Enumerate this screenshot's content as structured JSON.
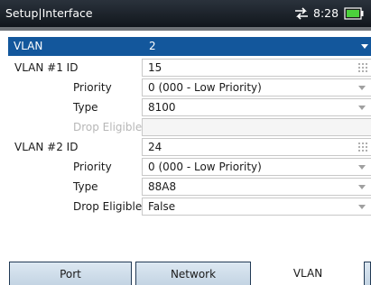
{
  "title_bar": {
    "title": "Setup|Interface",
    "time": "8:28",
    "network_icon": "network-transfer-icon",
    "battery_icon": "battery-icon"
  },
  "vlan": {
    "label": "VLAN",
    "value": "2"
  },
  "vlan1": {
    "id_label": "VLAN #1 ID",
    "id_value": "15",
    "priority_label": "Priority",
    "priority_value": "0 (000 - Low Priority)",
    "type_label": "Type",
    "type_value": "8100",
    "drop_label": "Drop Eligible",
    "drop_value": ""
  },
  "vlan2": {
    "id_label": "VLAN #2 ID",
    "id_value": "24",
    "priority_label": "Priority",
    "priority_value": "0 (000 - Low Priority)",
    "type_label": "Type",
    "type_value": "88A8",
    "drop_label": "Drop Eligible",
    "drop_value": "False"
  },
  "tabs": [
    {
      "label": "Port",
      "active": false
    },
    {
      "label": "Network",
      "active": false
    },
    {
      "label": "VLAN",
      "active": true
    }
  ],
  "colors": {
    "header_blue": "#13579c",
    "title_bar": "#1b2128",
    "tab_inactive": "#d3e0ec"
  }
}
